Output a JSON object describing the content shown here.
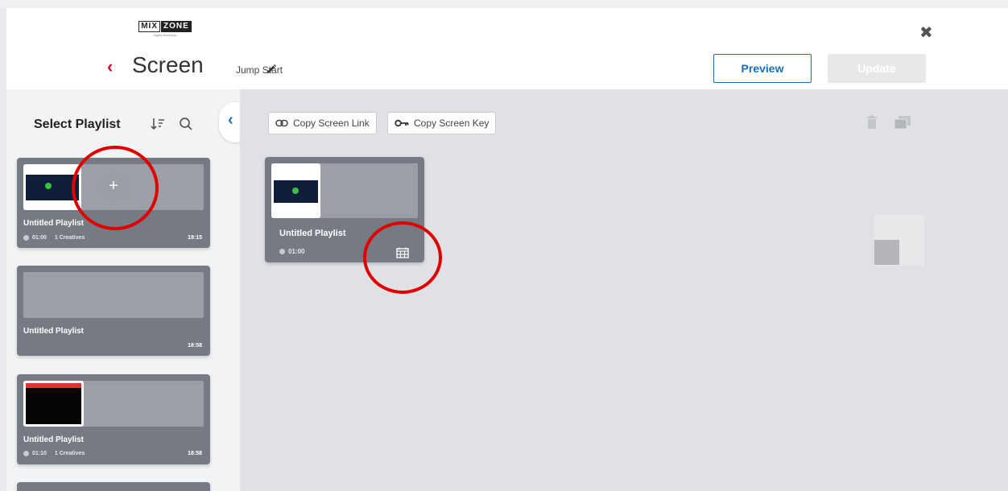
{
  "header": {
    "logo_left": "MIX",
    "logo_right": "ZONE",
    "logo_tagline": "Digital Backdrop",
    "back_icon": "chevron-left-icon",
    "title": "Screen",
    "subtitle": "Jump Start",
    "edit_icon": "pencil-icon",
    "close_icon": "close-icon",
    "preview_label": "Preview",
    "update_label": "Update"
  },
  "sidebar": {
    "title": "Select Playlist",
    "sort_icon": "sort-icon",
    "search_icon": "search-icon",
    "collapse_icon": "chevron-left-icon",
    "playlists": [
      {
        "name": "Untitled Playlist",
        "duration": "01:00",
        "creatives": "1 Creatives",
        "time": "19:15"
      },
      {
        "name": "Untitled Playlist",
        "duration": "",
        "creatives": "",
        "time": "18:58"
      },
      {
        "name": "Untitled Playlist",
        "duration": "01:10",
        "creatives": "1 Creatives",
        "time": "18:58"
      }
    ]
  },
  "main": {
    "copy_link_label": "Copy Screen Link",
    "copy_key_label": "Copy Screen Key",
    "link_icon": "link-icon",
    "key_icon": "key-icon",
    "trash_icon": "trash-icon",
    "layers_icon": "layers-icon",
    "assigned": {
      "name": "Untitled Playlist",
      "duration": "01:00",
      "schedule_icon": "calendar-icon"
    }
  },
  "colors": {
    "accent": "#1a6fb5",
    "back_chevron": "#c8102e",
    "card_bg": "#767b83",
    "highlight_circle": "#e00000"
  }
}
